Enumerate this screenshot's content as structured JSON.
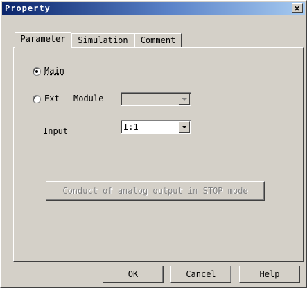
{
  "window": {
    "title": "Property",
    "close_label": "×"
  },
  "tabs": [
    {
      "label": "Parameter",
      "active": true
    },
    {
      "label": "Simulation",
      "active": false
    },
    {
      "label": "Comment",
      "active": false
    }
  ],
  "parameter": {
    "radio_main": {
      "label": "Main",
      "checked": true
    },
    "radio_ext": {
      "label": "Ext",
      "checked": false
    },
    "module_label": "Module",
    "module_value": "",
    "input_label": "Input",
    "input_value": "I:1",
    "conduct_button": "Conduct of analog output in STOP  mode"
  },
  "footer": {
    "ok_label": "OK",
    "cancel_label": "Cancel",
    "help_label": "Help"
  }
}
